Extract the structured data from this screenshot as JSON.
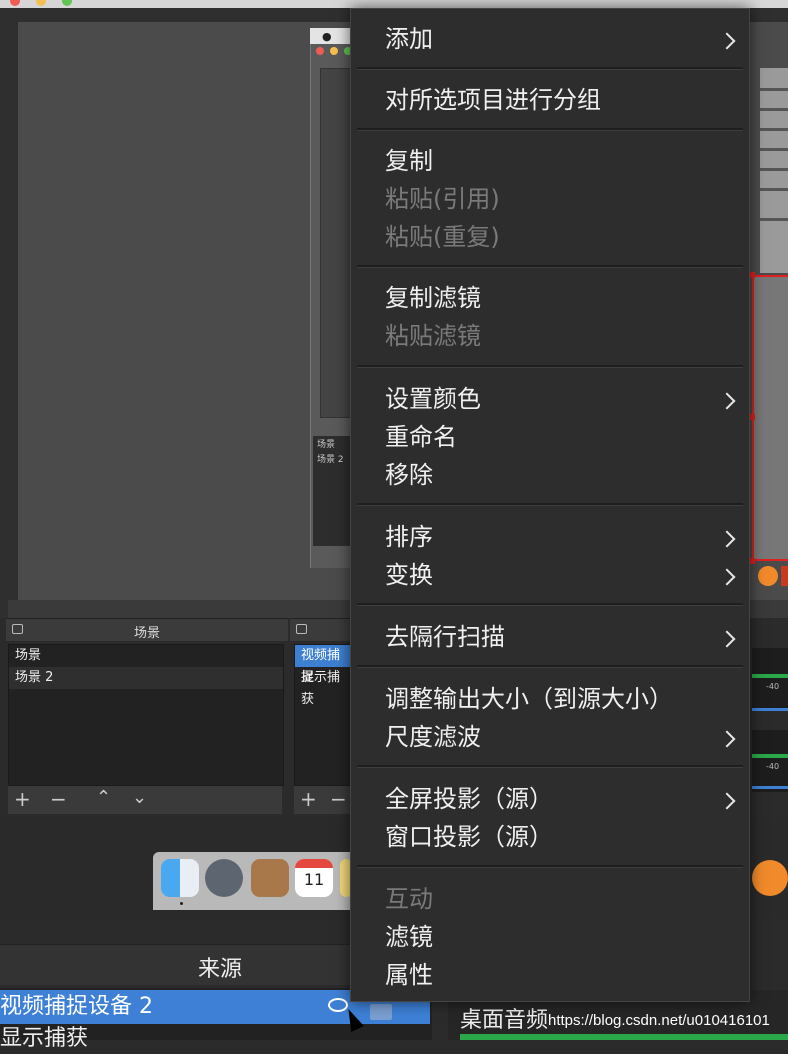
{
  "app": {
    "scenes_title": "场景",
    "scenes": [
      "场景",
      "场景 2"
    ],
    "sources_panel_items": [
      "视频捕捉",
      "显示捕获"
    ],
    "nested_scenes": [
      "场景",
      "场景 2"
    ],
    "calendar_day": "11",
    "sources_title": "来源",
    "selected_source": "视频捕捉设备 2",
    "second_source": "显示捕获",
    "mixer_channel": "桌面音频",
    "meter_label": "-40",
    "watermark": "https://blog.csdn.net/u010416101"
  },
  "menu": {
    "items": [
      {
        "label": "添加",
        "submenu": true,
        "enabled": true
      },
      {
        "label": "对所选项目进行分组",
        "submenu": false,
        "enabled": true
      },
      {
        "label": "复制",
        "submenu": false,
        "enabled": true
      },
      {
        "label": "粘贴(引用)",
        "submenu": false,
        "enabled": false
      },
      {
        "label": "粘贴(重复)",
        "submenu": false,
        "enabled": false
      },
      {
        "label": "复制滤镜",
        "submenu": false,
        "enabled": true
      },
      {
        "label": "粘贴滤镜",
        "submenu": false,
        "enabled": false
      },
      {
        "label": "设置颜色",
        "submenu": true,
        "enabled": true
      },
      {
        "label": "重命名",
        "submenu": false,
        "enabled": true
      },
      {
        "label": "移除",
        "submenu": false,
        "enabled": true
      },
      {
        "label": "排序",
        "submenu": true,
        "enabled": true
      },
      {
        "label": "变换",
        "submenu": true,
        "enabled": true
      },
      {
        "label": "去隔行扫描",
        "submenu": true,
        "enabled": true
      },
      {
        "label": "调整输出大小（到源大小）",
        "submenu": false,
        "enabled": true
      },
      {
        "label": "尺度滤波",
        "submenu": true,
        "enabled": true
      },
      {
        "label": "全屏投影（源）",
        "submenu": true,
        "enabled": true
      },
      {
        "label": "窗口投影（源）",
        "submenu": false,
        "enabled": true
      },
      {
        "label": "互动",
        "submenu": false,
        "enabled": false
      },
      {
        "label": "滤镜",
        "submenu": false,
        "enabled": true
      },
      {
        "label": "属性",
        "submenu": false,
        "enabled": true
      }
    ]
  },
  "colors": {
    "selection": "#3d80d6",
    "menu_bg": "#2d2d2d",
    "disabled_text": "#7a7a7a",
    "preview_red": "#e0201e"
  }
}
